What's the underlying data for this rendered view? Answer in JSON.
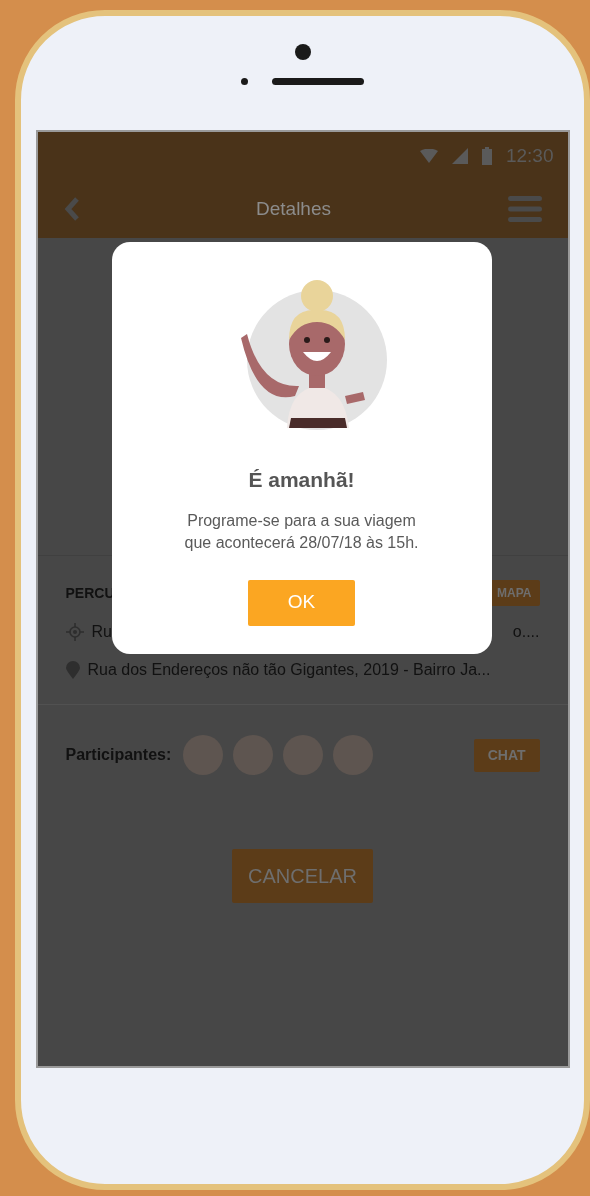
{
  "status_bar": {
    "time": "12:30"
  },
  "toolbar": {
    "title": "Detalhes"
  },
  "route": {
    "heading": "PERCU",
    "map_button": "MAPA",
    "origin_start": "Ru",
    "origin_end": "o....",
    "destination": "Rua dos Endereços não tão Gigantes, 2019 - Bairro Ja..."
  },
  "participants": {
    "label": "Participantes:",
    "avatars": [
      {
        "kind": "photo"
      },
      {
        "kind": "photo"
      },
      {
        "kind": "photo"
      },
      {
        "kind": "photo"
      }
    ],
    "chat_button": "CHAT"
  },
  "cancel_button": "CANCELAR",
  "dialog": {
    "title": "É amanhã!",
    "message_lines": [
      "Programe-se para a sua viagem",
      "que acontecerá 28/07/18 às 15h."
    ],
    "ok_button": "OK"
  }
}
